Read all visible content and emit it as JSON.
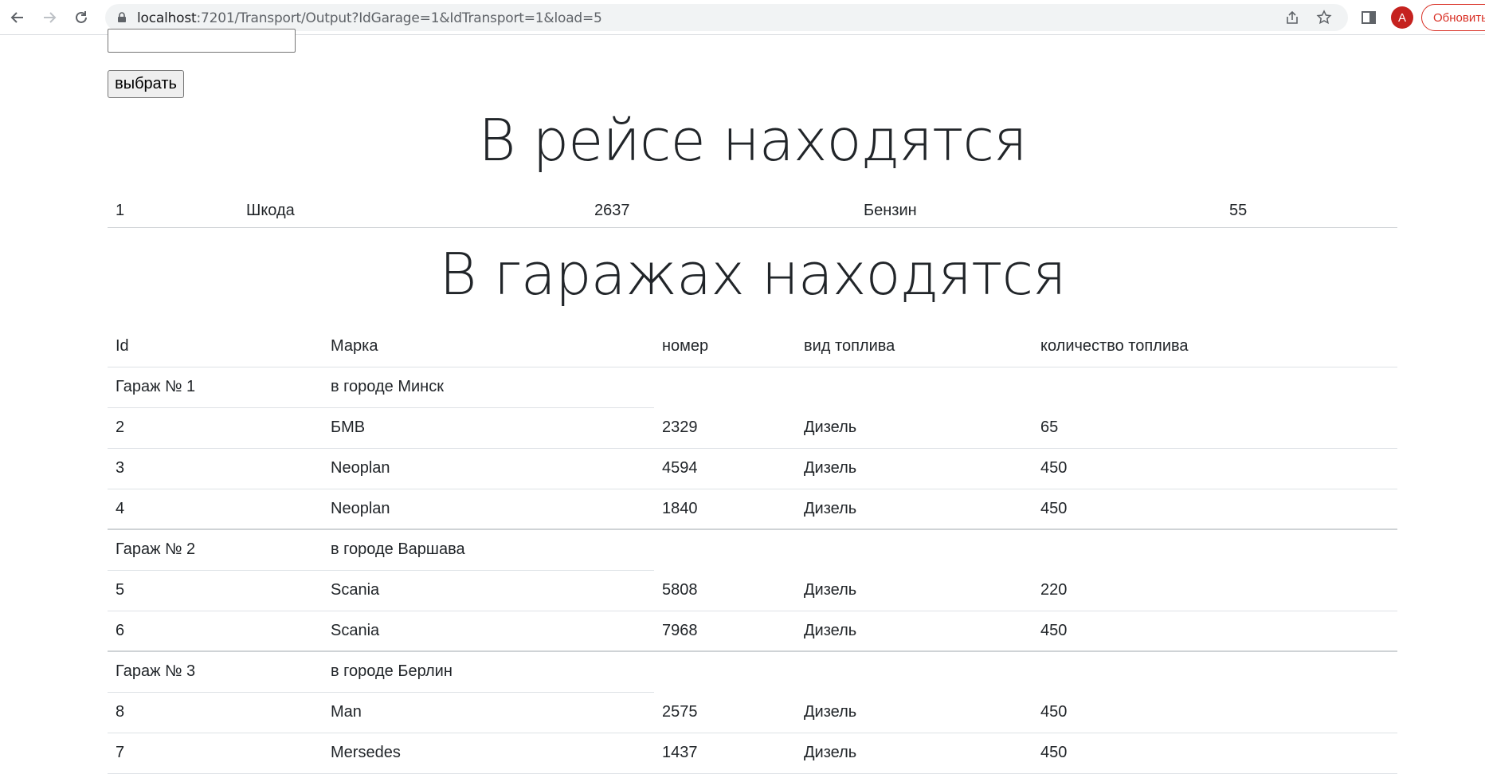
{
  "browser": {
    "url_host": "localhost",
    "url_rest": ":7201/Transport/Output?IdGarage=1&IdTransport=1&load=5",
    "avatar_letter": "A",
    "update_label": "Обновить"
  },
  "form": {
    "input_value": "",
    "select_label": "выбрать"
  },
  "trip": {
    "title": "В рейсе находятся",
    "rows": [
      {
        "id": "1",
        "brand": "Шкода",
        "number": "2637",
        "fuel_type": "Бензин",
        "fuel_amount": "55"
      }
    ]
  },
  "garages": {
    "title": "В гаражах находятся",
    "headers": {
      "id": "Id",
      "brand": "Марка",
      "number": "номер",
      "fuel_type": "вид топлива",
      "fuel_amount": "количество топлива"
    },
    "groups": [
      {
        "name": "Гараж № 1",
        "city": "в городе Минск",
        "rows": [
          {
            "id": "2",
            "brand": "БМВ",
            "number": "2329",
            "fuel_type": "Дизель",
            "fuel_amount": "65"
          },
          {
            "id": "3",
            "brand": "Neoplan",
            "number": "4594",
            "fuel_type": "Дизель",
            "fuel_amount": "450"
          },
          {
            "id": "4",
            "brand": "Neoplan",
            "number": "1840",
            "fuel_type": "Дизель",
            "fuel_amount": "450"
          }
        ]
      },
      {
        "name": "Гараж № 2",
        "city": "в городе Варшава",
        "rows": [
          {
            "id": "5",
            "brand": "Scania",
            "number": "5808",
            "fuel_type": "Дизель",
            "fuel_amount": "220"
          },
          {
            "id": "6",
            "brand": "Scania",
            "number": "7968",
            "fuel_type": "Дизель",
            "fuel_amount": "450"
          }
        ]
      },
      {
        "name": "Гараж № 3",
        "city": "в городе Берлин",
        "rows": [
          {
            "id": "8",
            "brand": "Man",
            "number": "2575",
            "fuel_type": "Дизель",
            "fuel_amount": "450"
          },
          {
            "id": "7",
            "brand": "Mersedes",
            "number": "1437",
            "fuel_type": "Дизель",
            "fuel_amount": "450"
          }
        ]
      }
    ]
  }
}
